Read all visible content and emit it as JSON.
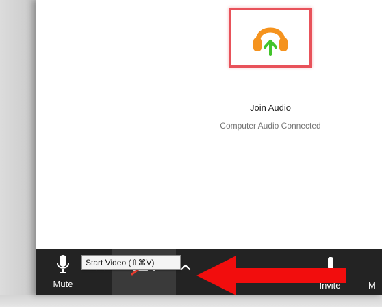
{
  "main": {
    "join_audio_title": "Join Audio",
    "join_audio_status": "Computer Audio Connected",
    "join_audio_icon": "headphones-upload-icon"
  },
  "toolbar": {
    "mute_label": "Mute",
    "invite_label": "Invite",
    "more_label": "M",
    "video_icon": "video-off-icon",
    "mic_icon": "microphone-icon"
  },
  "tooltip": {
    "text": "Start Video (⇧⌘V)"
  },
  "annotation": {
    "arrow_color": "#f20d0d",
    "highlight_color": "#e8525a"
  },
  "colors": {
    "headphone_orange": "#f5931e",
    "upload_green": "#43c42b",
    "toolbar_bg": "#232323"
  }
}
